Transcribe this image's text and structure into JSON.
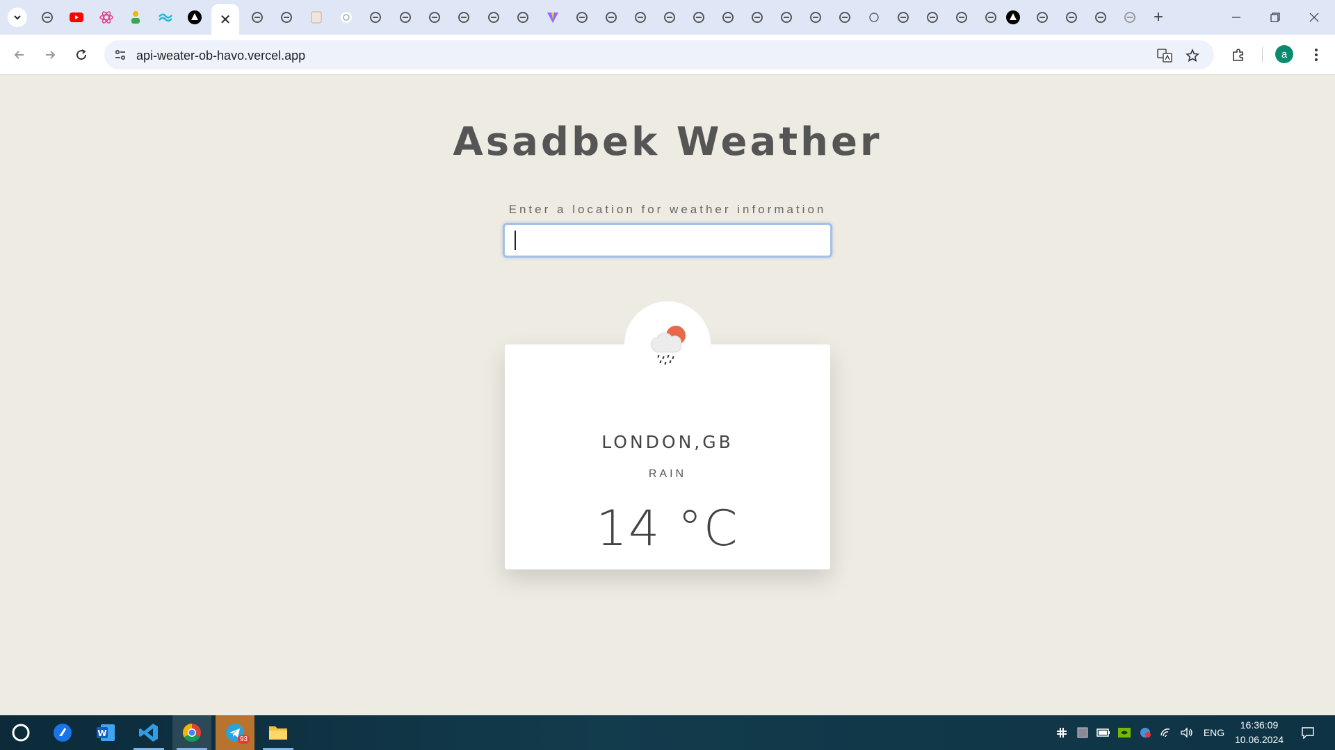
{
  "browser": {
    "url": "api-weater-ob-havo.vercel.app",
    "active_tab_close_glyph": "✕",
    "profile_initial": "a",
    "new_tab_glyph": "+"
  },
  "app": {
    "title": "Asadbek Weather",
    "search_label": "Enter a location for weather information",
    "search_value": "",
    "search_placeholder": ""
  },
  "weather": {
    "location": "LONDON,GB",
    "condition": "RAIN",
    "temperature": "14 °C",
    "icon": "rain-cloud-sun-icon"
  },
  "taskbar": {
    "telegram_badge": "93",
    "language": "ENG",
    "time": "16:36:09",
    "date": "10.06.2024"
  },
  "colors": {
    "page_background": "#edebe2",
    "sun": "#e8694a",
    "input_focus": "#a3c1e6"
  }
}
